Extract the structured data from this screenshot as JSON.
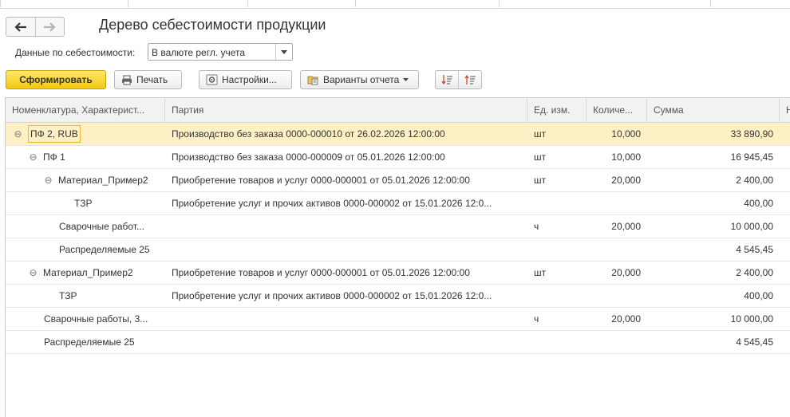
{
  "window": {
    "title": "Дерево себестоимости продукции"
  },
  "filter": {
    "label": "Данные по себестоимости:",
    "value": "В валюте регл. учета"
  },
  "toolbar": {
    "form_label": "Сформировать",
    "print_label": "Печать",
    "settings_label": "Настройки...",
    "variants_label": "Варианты отчета"
  },
  "table": {
    "columns": [
      "Номенклатура, Характерист...",
      "Партия",
      "Ед. изм.",
      "Количе...",
      "Сумма",
      "Н"
    ],
    "rows": [
      {
        "name": "ПФ 2, RUB",
        "batch": "Производство без заказа 0000-000010 от 26.02.2026 12:00:00",
        "unit": "шт",
        "qty": "10,000",
        "sum": "33 890,90"
      },
      {
        "name": "ПФ 1",
        "batch": "Производство без заказа 0000-000009 от 05.01.2026 12:00:00",
        "unit": "шт",
        "qty": "10,000",
        "sum": "16 945,45"
      },
      {
        "name": "Материал_Пример2",
        "batch": "Приобретение товаров и услуг 0000-000001 от 05.01.2026 12:00:00",
        "unit": "шт",
        "qty": "20,000",
        "sum": "2 400,00"
      },
      {
        "name": "ТЗР",
        "batch": "Приобретение услуг и прочих активов 0000-000002 от 15.01.2026 12:0...",
        "unit": "",
        "qty": "",
        "sum": "400,00"
      },
      {
        "name": "Сварочные работ...",
        "batch": "",
        "unit": "ч",
        "qty": "20,000",
        "sum": "10 000,00"
      },
      {
        "name": "Распределяемые 25",
        "batch": "",
        "unit": "",
        "qty": "",
        "sum": "4 545,45"
      },
      {
        "name": "Материал_Пример2",
        "batch": "Приобретение товаров и услуг 0000-000001 от 05.01.2026 12:00:00",
        "unit": "шт",
        "qty": "20,000",
        "sum": "2 400,00"
      },
      {
        "name": "ТЗР",
        "batch": "Приобретение услуг и прочих активов 0000-000002 от 15.01.2026 12:0...",
        "unit": "",
        "qty": "",
        "sum": "400,00"
      },
      {
        "name": "Сварочные работы, 3...",
        "batch": "",
        "unit": "ч",
        "qty": "20,000",
        "sum": "10 000,00"
      },
      {
        "name": "Распределяемые 25",
        "batch": "",
        "unit": "",
        "qty": "",
        "sum": "4 545,45"
      }
    ]
  },
  "icons": {
    "back": "arrow-left-icon",
    "forward": "arrow-right-icon",
    "print": "printer-icon",
    "settings": "settings-icon",
    "variants": "report-variants-icon",
    "dropdown": "chevron-down-icon",
    "collapse": "minus-circle-icon",
    "sort_asc": "sort-ascending-icon",
    "sort_desc": "sort-descending-icon"
  },
  "colors": {
    "primary_button": "#f5d12a",
    "selected_row": "#fdf0c4",
    "focus_border": "#e8b93a"
  }
}
